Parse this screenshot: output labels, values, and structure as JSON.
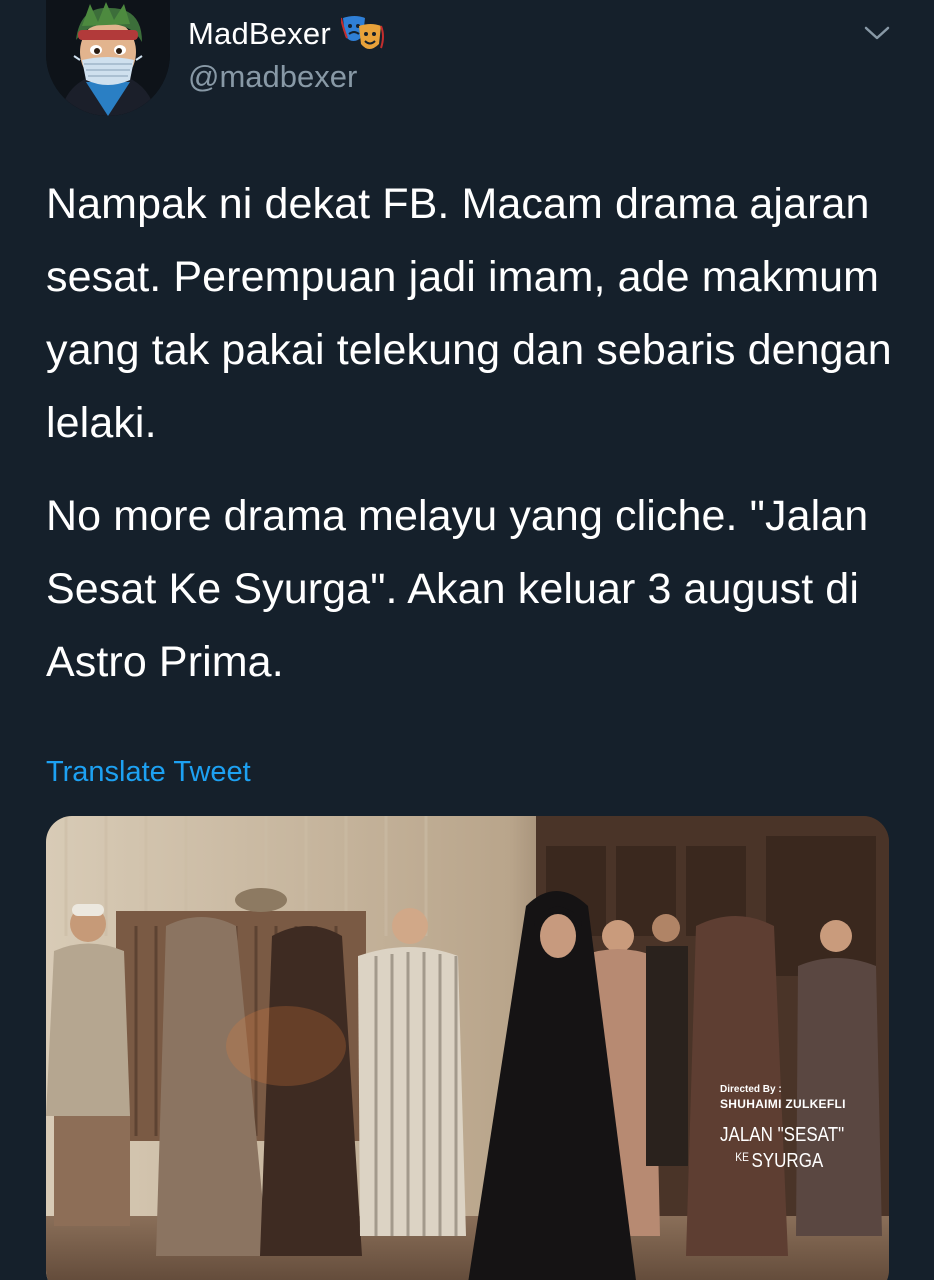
{
  "user": {
    "display_name": "MadBexer",
    "handle": "@madbexer",
    "badge_icon": "theater-masks-icon",
    "avatar_icon": "masked-cartoon-avatar"
  },
  "tweet": {
    "paragraph_1": "Nampak ni dekat FB. Macam drama ajaran sesat. Perempuan jadi imam, ade makmum yang tak pakai telekung dan sebaris dengan lelaki.",
    "paragraph_2": "No more drama melayu yang cliche. \"Jalan Sesat Ke Syurga\". Akan keluar 3 august di Astro Prima.",
    "translate_label": "Translate Tweet"
  },
  "media": {
    "directed_by": "Directed By :",
    "director": "SHUHAIMI ZULKEFLI",
    "title_line_1": "JALAN \"SESAT\"",
    "title_ke": "KE",
    "title_line_2": "SYURGA"
  },
  "colors": {
    "background": "#15202b",
    "text": "#ffffff",
    "secondary_text": "#8899a6",
    "link": "#1da1f2"
  }
}
